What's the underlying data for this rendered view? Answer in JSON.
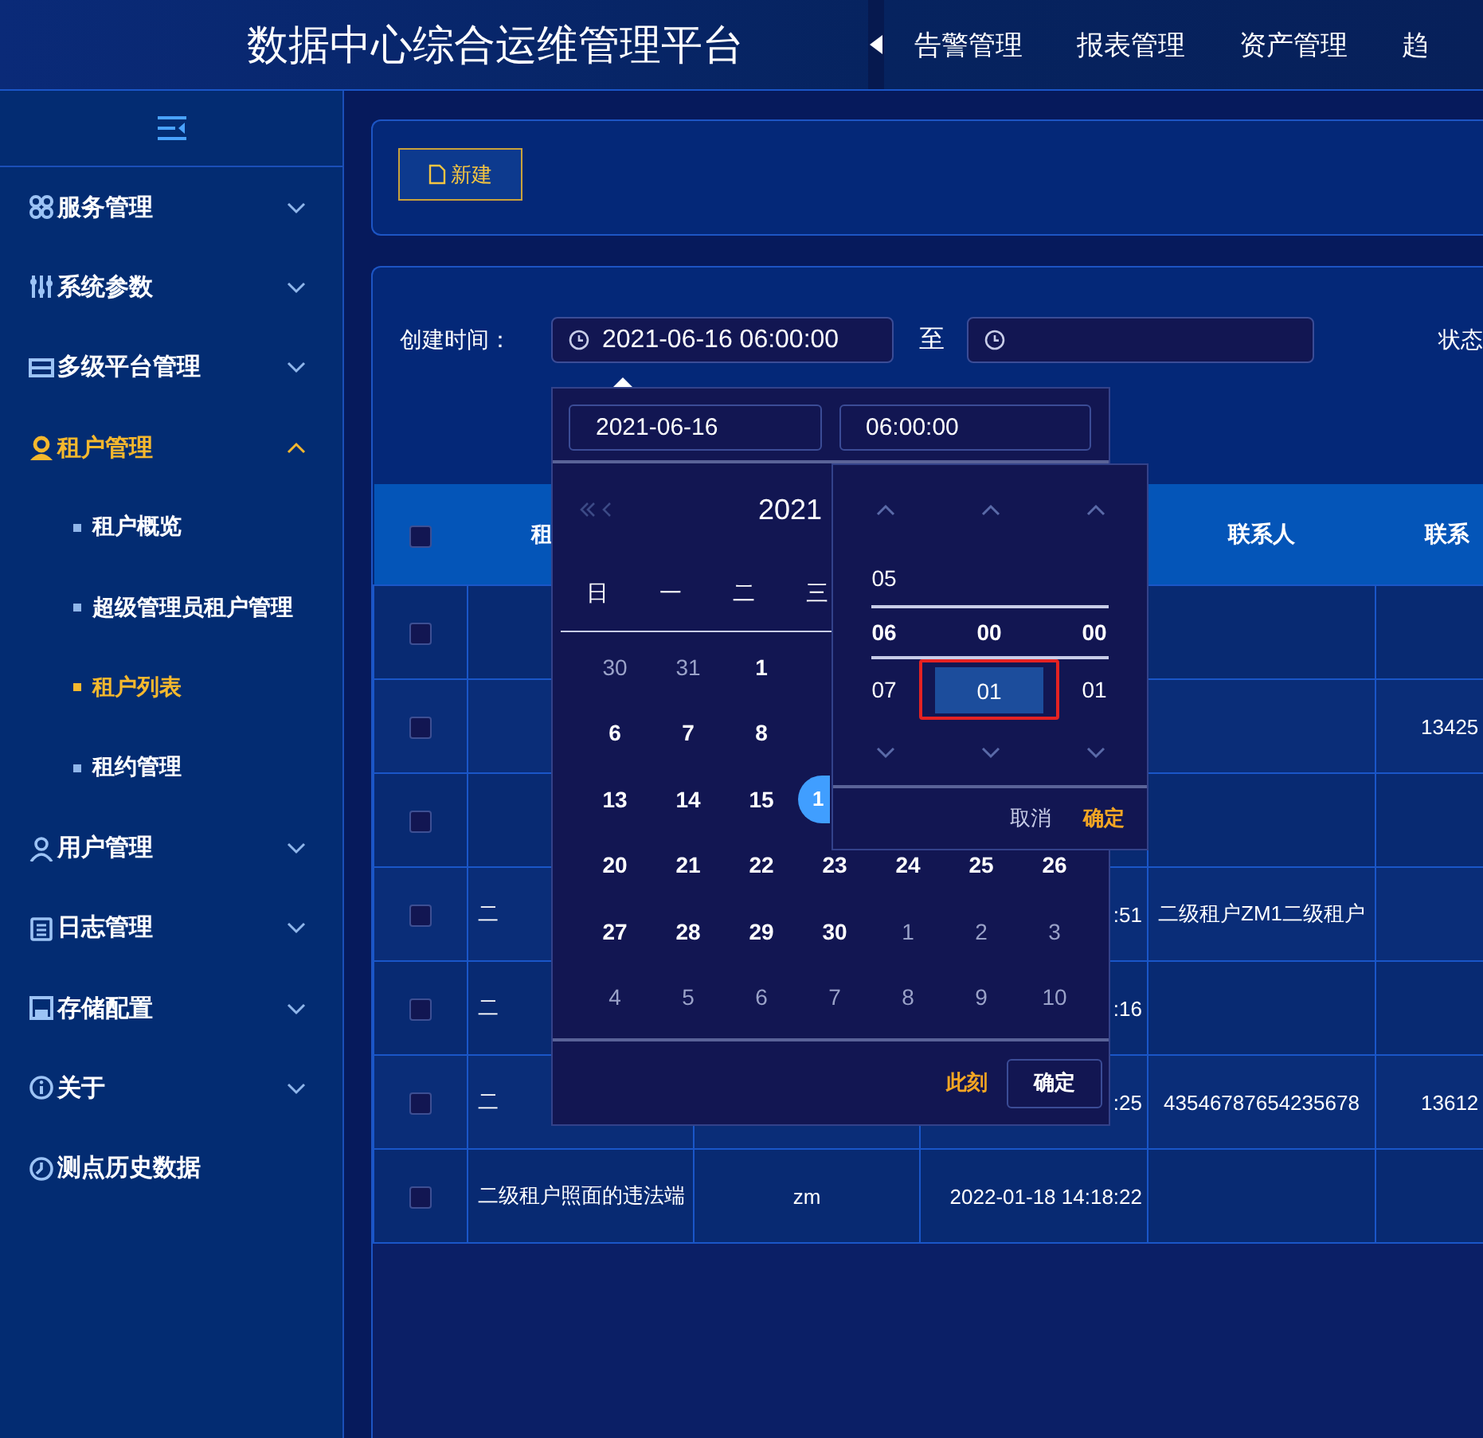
{
  "header": {
    "title": "数据中心综合运维管理平台",
    "nav_items": [
      "告警管理",
      "报表管理",
      "资产管理",
      "趋"
    ]
  },
  "sidebar": {
    "items": [
      {
        "label": "服务管理",
        "kind": "group",
        "expanded": false,
        "selected": false
      },
      {
        "label": "系统参数",
        "kind": "group",
        "expanded": false,
        "selected": false
      },
      {
        "label": "多级平台管理",
        "kind": "group",
        "expanded": false,
        "selected": false
      },
      {
        "label": "租户管理",
        "kind": "group",
        "expanded": true,
        "selected": true,
        "children": [
          {
            "label": "租户概览",
            "selected": false
          },
          {
            "label": "超级管理员租户管理",
            "selected": false
          },
          {
            "label": "租户列表",
            "selected": true
          },
          {
            "label": "租约管理",
            "selected": false
          }
        ]
      },
      {
        "label": "用户管理",
        "kind": "group",
        "expanded": false,
        "selected": false
      },
      {
        "label": "日志管理",
        "kind": "group",
        "expanded": false,
        "selected": false
      },
      {
        "label": "存储配置",
        "kind": "group",
        "expanded": false,
        "selected": false
      },
      {
        "label": "关于",
        "kind": "group",
        "expanded": false,
        "selected": false
      },
      {
        "label": "测点历史数据",
        "kind": "link",
        "selected": false
      }
    ]
  },
  "toolbar": {
    "new_button": "新建"
  },
  "filters": {
    "created_label": "创建时间：",
    "start_value": "2021-06-16 06:00:00",
    "separator": "至",
    "status_label": "状态"
  },
  "table": {
    "header_checked": false,
    "header": {
      "column_2": "租",
      "column_5": "联系人",
      "column_6": "联系"
    },
    "rows": [
      {
        "checked": false
      },
      {
        "checked": false,
        "column_6": "13425"
      },
      {
        "checked": false
      },
      {
        "checked": false,
        "column_2": "二",
        "column_4": ":51",
        "column_5": "二级租户ZM1二级租户"
      },
      {
        "checked": false,
        "column_2": "二",
        "column_4": ":16"
      },
      {
        "checked": false,
        "column_2": "二",
        "column_4": ":25",
        "column_5": "43546787654235678",
        "column_6": "13612"
      },
      {
        "checked": false,
        "column_2": "二级租户照面的违法端",
        "column_3": "zm",
        "column_4": "2022-01-18 14:18:22"
      }
    ]
  },
  "date_picker": {
    "date_input": "2021-06-16",
    "time_input": "06:00:00",
    "year": "2021",
    "weekdays": [
      "日",
      "一",
      "二",
      "三"
    ],
    "weeks": [
      {
        "days": [
          {
            "text": "30",
            "kind": "other",
            "selected": false
          },
          {
            "text": "31",
            "kind": "other",
            "selected": false
          },
          {
            "text": "1",
            "kind": "current",
            "selected": false
          }
        ]
      },
      {
        "days": [
          {
            "text": "6",
            "kind": "current",
            "selected": false
          },
          {
            "text": "7",
            "kind": "current",
            "selected": false
          },
          {
            "text": "8",
            "kind": "current",
            "selected": false
          }
        ]
      },
      {
        "days": [
          {
            "text": "13",
            "kind": "current",
            "selected": false
          },
          {
            "text": "14",
            "kind": "current",
            "selected": false
          },
          {
            "text": "15",
            "kind": "current",
            "selected": false
          },
          {
            "text": "1",
            "kind": "current",
            "selected": true
          }
        ]
      },
      {
        "days": [
          {
            "text": "20",
            "kind": "current",
            "selected": false
          },
          {
            "text": "21",
            "kind": "current",
            "selected": false
          },
          {
            "text": "22",
            "kind": "current",
            "selected": false
          },
          {
            "text": "23",
            "kind": "current",
            "selected": false
          },
          {
            "text": "24",
            "kind": "current",
            "selected": false
          },
          {
            "text": "25",
            "kind": "current",
            "selected": false
          },
          {
            "text": "26",
            "kind": "current",
            "selected": false
          }
        ]
      },
      {
        "days": [
          {
            "text": "27",
            "kind": "current",
            "selected": false
          },
          {
            "text": "28",
            "kind": "current",
            "selected": false
          },
          {
            "text": "29",
            "kind": "current",
            "selected": false
          },
          {
            "text": "30",
            "kind": "current",
            "selected": false
          },
          {
            "text": "1",
            "kind": "other",
            "selected": false
          },
          {
            "text": "2",
            "kind": "other",
            "selected": false
          },
          {
            "text": "3",
            "kind": "other",
            "selected": false
          }
        ]
      },
      {
        "days": [
          {
            "text": "4",
            "kind": "other",
            "selected": false
          },
          {
            "text": "5",
            "kind": "other",
            "selected": false
          },
          {
            "text": "6",
            "kind": "other",
            "selected": false
          },
          {
            "text": "7",
            "kind": "other",
            "selected": false
          },
          {
            "text": "8",
            "kind": "other",
            "selected": false
          },
          {
            "text": "9",
            "kind": "other",
            "selected": false
          },
          {
            "text": "10",
            "kind": "other",
            "selected": false
          }
        ]
      }
    ],
    "now_button": "此刻",
    "confirm_button": "确定",
    "time_panel": {
      "rows": [
        {
          "selected": false,
          "cells": [
            {
              "text": "05",
              "highlighted": false
            }
          ]
        },
        {
          "selected": true,
          "cells": [
            {
              "text": "06",
              "highlighted": false
            },
            {
              "text": "00",
              "highlighted": false
            },
            {
              "text": "00",
              "highlighted": false
            }
          ]
        },
        {
          "selected": false,
          "cells": [
            {
              "text": "07",
              "highlighted": false
            },
            {
              "text": "01",
              "highlighted": true
            },
            {
              "text": "01",
              "highlighted": false
            }
          ]
        }
      ],
      "cancel_button": "取消",
      "confirm_button": "确定"
    }
  }
}
